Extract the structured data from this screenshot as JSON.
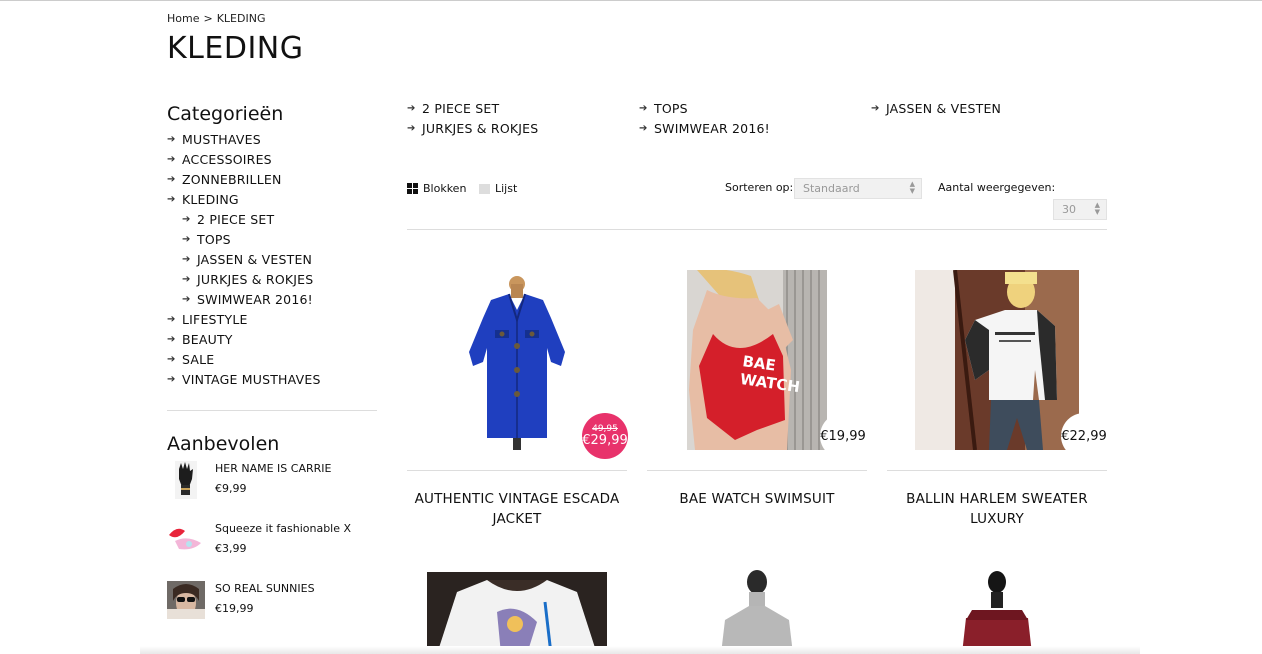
{
  "breadcrumb": {
    "home": "Home",
    "sep": ">",
    "current": "KLEDING"
  },
  "page_title": "KLEDING",
  "sidebar": {
    "categories_heading": "Categorieën",
    "categories": [
      {
        "label": "MUSTHAVES",
        "sub": false
      },
      {
        "label": "ACCESSOIRES",
        "sub": false
      },
      {
        "label": "ZONNEBRILLEN",
        "sub": false
      },
      {
        "label": "KLEDING",
        "sub": false
      },
      {
        "label": "2 PIECE SET",
        "sub": true
      },
      {
        "label": "TOPS",
        "sub": true
      },
      {
        "label": "JASSEN & VESTEN",
        "sub": true
      },
      {
        "label": "JURKJES & ROKJES",
        "sub": true
      },
      {
        "label": "SWIMWEAR 2016!",
        "sub": true
      },
      {
        "label": "LIFESTYLE",
        "sub": false
      },
      {
        "label": "BEAUTY",
        "sub": false
      },
      {
        "label": "SALE",
        "sub": false
      },
      {
        "label": "VINTAGE MUSTHAVES",
        "sub": false
      }
    ],
    "recommended_heading": "Aanbevolen",
    "recommended": [
      {
        "name": "HER NAME IS CARRIE",
        "price": "€9,99"
      },
      {
        "name": "Squeeze it fashionable X",
        "price": "€3,99"
      },
      {
        "name": "SO REAL SUNNIES",
        "price": "€19,99"
      }
    ]
  },
  "subcategories": [
    "2 PIECE SET",
    "TOPS",
    "JASSEN & VESTEN",
    "JURKJES & ROKJES",
    "SWIMWEAR 2016!"
  ],
  "toolbar": {
    "view_grid": "Blokken",
    "view_list": "Lijst",
    "sort_label": "Sorteren op:",
    "sort_value": "Standaard",
    "count_label": "Aantal weergegeven:",
    "count_value": "30"
  },
  "products": [
    {
      "title": "AUTHENTIC VINTAGE ESCADA JACKET",
      "old_price": "49,95",
      "price": "€29,99",
      "on_sale": true
    },
    {
      "title": "BAE WATCH SWIMSUIT",
      "price": "€19,99",
      "on_sale": false,
      "image_text": "BAE WATCH"
    },
    {
      "title": "BALLIN HARLEM SWEATER LUXURY",
      "price": "€22,99",
      "on_sale": false
    }
  ],
  "colors": {
    "sale_badge": "#e8326b",
    "divider": "#dddddd",
    "select_bg": "#f1f1f1"
  }
}
